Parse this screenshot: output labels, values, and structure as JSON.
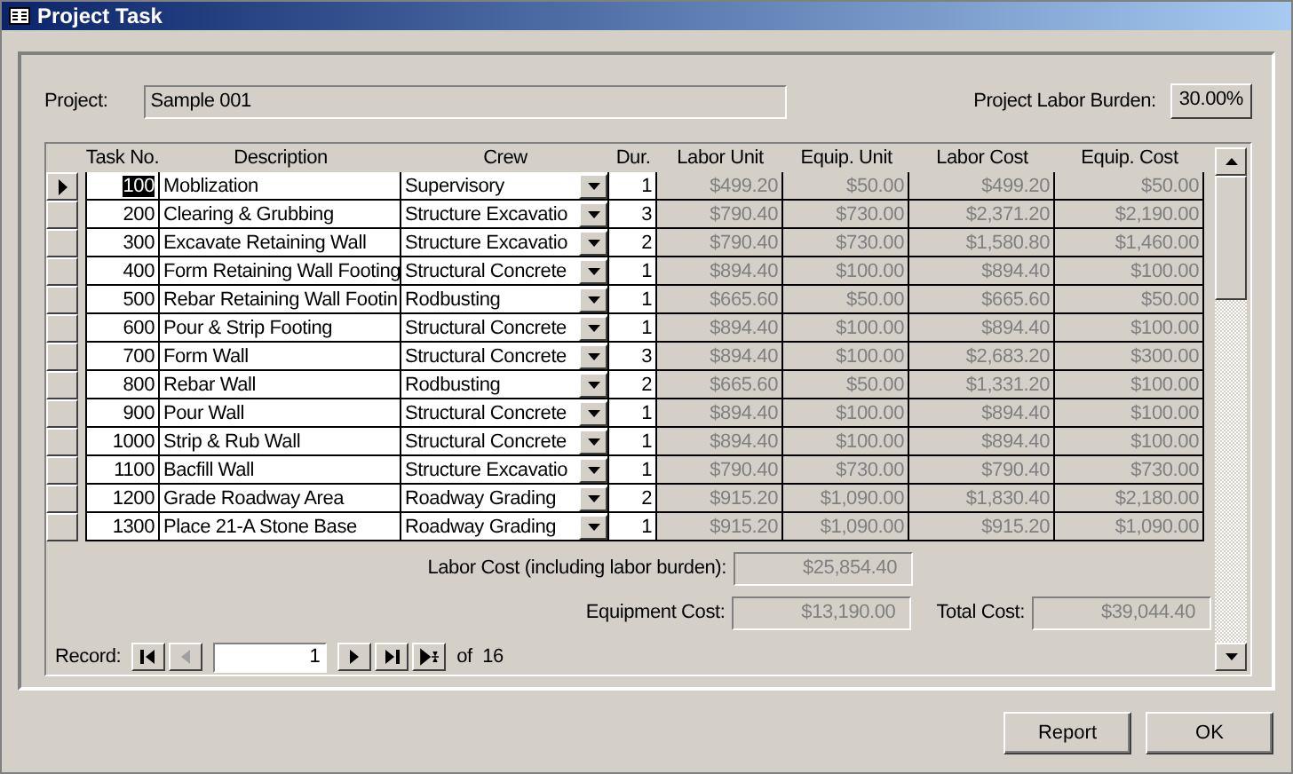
{
  "window": {
    "title": "Project Task"
  },
  "project": {
    "label": "Project:",
    "value": "Sample 001"
  },
  "labor_burden": {
    "label": "Project Labor Burden:",
    "value": "30.00%"
  },
  "table": {
    "columns": [
      "Task No.",
      "Description",
      "Crew",
      "Dur.",
      "Labor Unit",
      "Equip. Unit",
      "Labor Cost",
      "Equip. Cost"
    ],
    "rows": [
      {
        "selected": true,
        "task": "100",
        "description": "Moblization",
        "crew": "Supervisory",
        "dur": "1",
        "labor_unit": "$499.20",
        "equip_unit": "$50.00",
        "labor_cost": "$499.20",
        "equip_cost": "$50.00"
      },
      {
        "selected": false,
        "task": "200",
        "description": "Clearing & Grubbing",
        "crew": "Structure Excavatio",
        "dur": "3",
        "labor_unit": "$790.40",
        "equip_unit": "$730.00",
        "labor_cost": "$2,371.20",
        "equip_cost": "$2,190.00"
      },
      {
        "selected": false,
        "task": "300",
        "description": "Excavate Retaining Wall",
        "crew": "Structure Excavatio",
        "dur": "2",
        "labor_unit": "$790.40",
        "equip_unit": "$730.00",
        "labor_cost": "$1,580.80",
        "equip_cost": "$1,460.00"
      },
      {
        "selected": false,
        "task": "400",
        "description": "Form Retaining Wall Footing",
        "crew": "Structural Concrete",
        "dur": "1",
        "labor_unit": "$894.40",
        "equip_unit": "$100.00",
        "labor_cost": "$894.40",
        "equip_cost": "$100.00"
      },
      {
        "selected": false,
        "task": "500",
        "description": "Rebar Retaining Wall Footin",
        "crew": "Rodbusting",
        "dur": "1",
        "labor_unit": "$665.60",
        "equip_unit": "$50.00",
        "labor_cost": "$665.60",
        "equip_cost": "$50.00"
      },
      {
        "selected": false,
        "task": "600",
        "description": "Pour & Strip Footing",
        "crew": "Structural Concrete",
        "dur": "1",
        "labor_unit": "$894.40",
        "equip_unit": "$100.00",
        "labor_cost": "$894.40",
        "equip_cost": "$100.00"
      },
      {
        "selected": false,
        "task": "700",
        "description": "Form Wall",
        "crew": "Structural Concrete",
        "dur": "3",
        "labor_unit": "$894.40",
        "equip_unit": "$100.00",
        "labor_cost": "$2,683.20",
        "equip_cost": "$300.00"
      },
      {
        "selected": false,
        "task": "800",
        "description": "Rebar Wall",
        "crew": "Rodbusting",
        "dur": "2",
        "labor_unit": "$665.60",
        "equip_unit": "$50.00",
        "labor_cost": "$1,331.20",
        "equip_cost": "$100.00"
      },
      {
        "selected": false,
        "task": "900",
        "description": "Pour Wall",
        "crew": "Structural Concrete",
        "dur": "1",
        "labor_unit": "$894.40",
        "equip_unit": "$100.00",
        "labor_cost": "$894.40",
        "equip_cost": "$100.00"
      },
      {
        "selected": false,
        "task": "1000",
        "description": "Strip & Rub Wall",
        "crew": "Structural Concrete",
        "dur": "1",
        "labor_unit": "$894.40",
        "equip_unit": "$100.00",
        "labor_cost": "$894.40",
        "equip_cost": "$100.00"
      },
      {
        "selected": false,
        "task": "1100",
        "description": "Bacfill Wall",
        "crew": "Structure Excavatio",
        "dur": "1",
        "labor_unit": "$790.40",
        "equip_unit": "$730.00",
        "labor_cost": "$790.40",
        "equip_cost": "$730.00"
      },
      {
        "selected": false,
        "task": "1200",
        "description": "Grade Roadway Area",
        "crew": "Roadway Grading",
        "dur": "2",
        "labor_unit": "$915.20",
        "equip_unit": "$1,090.00",
        "labor_cost": "$1,830.40",
        "equip_cost": "$2,180.00"
      },
      {
        "selected": false,
        "task": "1300",
        "description": "Place 21-A Stone Base",
        "crew": "Roadway Grading",
        "dur": "1",
        "labor_unit": "$915.20",
        "equip_unit": "$1,090.00",
        "labor_cost": "$915.20",
        "equip_cost": "$1,090.00"
      }
    ]
  },
  "totals": {
    "labor_label": "Labor Cost (including labor burden):",
    "labor_value": "$25,854.40",
    "equipment_label": "Equipment Cost:",
    "equipment_value": "$13,190.00",
    "total_label": "Total Cost:",
    "total_value": "$39,044.40"
  },
  "navigator": {
    "label": "Record:",
    "current": "1",
    "count": "of  16",
    "buttons": [
      {
        "kind": "first",
        "disabled": false
      },
      {
        "kind": "prev",
        "disabled": true
      },
      {
        "kind": "next",
        "disabled": false
      },
      {
        "kind": "last",
        "disabled": false
      },
      {
        "kind": "new",
        "disabled": false
      }
    ]
  },
  "buttons": [
    "Report",
    "OK"
  ]
}
